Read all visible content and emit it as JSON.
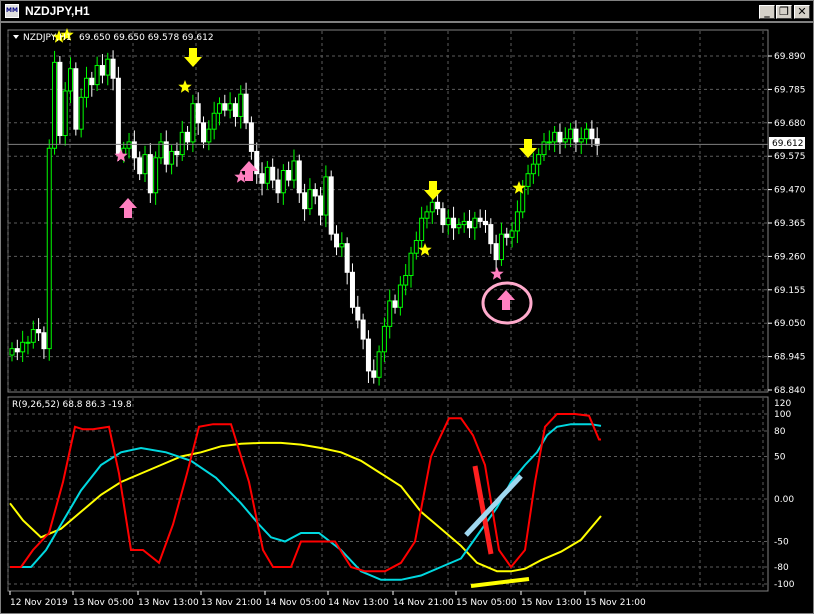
{
  "window": {
    "title": "NZDJPY,H1",
    "icon_label": "MM",
    "buttons": [
      {
        "name": "minimize-button",
        "label": "_"
      },
      {
        "name": "restore-button",
        "label": "❐"
      },
      {
        "name": "close-button",
        "label": "✕"
      }
    ]
  },
  "main_chart": {
    "symbol_label": "NZDJPY,H1",
    "ohlc": "69.650 69.650 69.578 69.612",
    "current_price": "69.612",
    "price_ticks": [
      "69.890",
      "69.785",
      "69.680",
      "69.575",
      "69.470",
      "69.365",
      "69.260",
      "69.155",
      "69.050",
      "68.945",
      "68.840"
    ]
  },
  "indicator": {
    "label": "R(9,26,52) 68.8 86.3 -19.8",
    "ticks": [
      "120",
      "100",
      "80",
      "50",
      "0.00",
      "-50",
      "-80",
      "-100"
    ]
  },
  "time_axis": [
    "12 Nov 2019",
    "13 Nov 05:00",
    "13 Nov 13:00",
    "13 Nov 21:00",
    "14 Nov 05:00",
    "14 Nov 13:00",
    "14 Nov 21:00",
    "15 Nov 05:00",
    "15 Nov 13:00",
    "15 Nov 21:00"
  ],
  "colors": {
    "background": "#000000",
    "bull_candle": "#00ff00",
    "bear_candle": "#ffffff",
    "grid": "#5c5c5c",
    "red_line": "#ff0000",
    "cyan_line": "#00d8e0",
    "yellow_line": "#ffff00",
    "buy_arrow": "#ff80c0",
    "sell_arrow": "#ffff00"
  }
}
